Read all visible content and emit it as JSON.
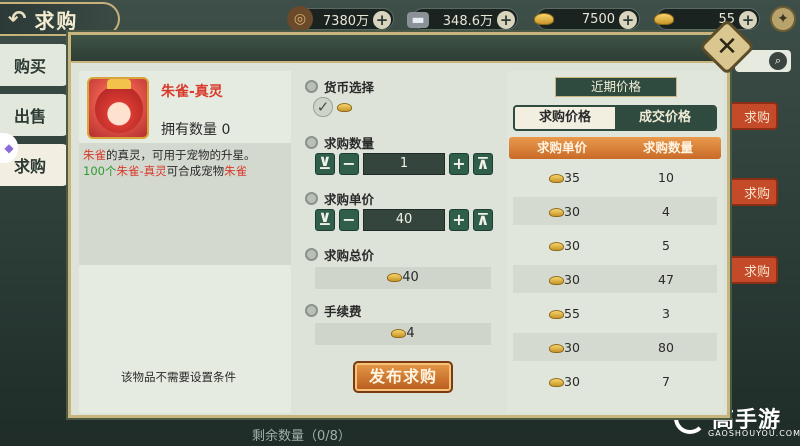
{
  "window": {
    "title": "求购"
  },
  "resources": [
    {
      "icon": "copper-coin-icon",
      "value": "7380万"
    },
    {
      "icon": "silver-ingot-icon",
      "value": "348.6万"
    },
    {
      "icon": "gold-ingot-icon",
      "value": "7500"
    },
    {
      "icon": "gold-ingot-icon",
      "value": "55"
    }
  ],
  "left_tabs": [
    {
      "label": "购买"
    },
    {
      "label": "出售"
    },
    {
      "label": "求购"
    }
  ],
  "item": {
    "name": "朱雀-真灵",
    "owned_label": "拥有数量 0",
    "desc1_a": "朱雀",
    "desc1_b": "的真灵，可用于宠物的升星。",
    "desc2_a": "100个",
    "desc2_b": "朱雀-真灵",
    "desc2_c": "可合成宠物",
    "desc2_d": "朱雀",
    "no_condition": "该物品不需要设置条件"
  },
  "form": {
    "currency_label": "货币选择",
    "quantity_label": "求购数量",
    "quantity_value": "1",
    "unit_price_label": "求购单价",
    "unit_price_value": "40",
    "total_label": "求购总价",
    "total_value": "40",
    "fee_label": "手续费",
    "fee_value": "4",
    "publish": "发布求购"
  },
  "stepper_glyphs": {
    "min": "⊻",
    "minus": "−",
    "plus": "+",
    "max": "⊼"
  },
  "prices": {
    "title": "近期价格",
    "tab_active": "求购价格",
    "tab_inactive": "成交价格",
    "col_price": "求购单价",
    "col_qty": "求购数量",
    "rows": [
      {
        "price": "35",
        "qty": "10"
      },
      {
        "price": "30",
        "qty": "4"
      },
      {
        "price": "30",
        "qty": "5"
      },
      {
        "price": "30",
        "qty": "47"
      },
      {
        "price": "55",
        "qty": "3"
      },
      {
        "price": "30",
        "qty": "80"
      },
      {
        "price": "30",
        "qty": "7"
      }
    ]
  },
  "background": {
    "btn_label": "求购",
    "remaining": "剩余数量（0/8）",
    "watermark_brand": "高手游",
    "watermark_url": "GAOSHOUYOU.COM"
  },
  "colors": {
    "accent_red": "#d83a2c",
    "accent_green": "#2f9a2f",
    "header_dark": "#2f4a3e",
    "gold_border": "#c8b57e"
  }
}
